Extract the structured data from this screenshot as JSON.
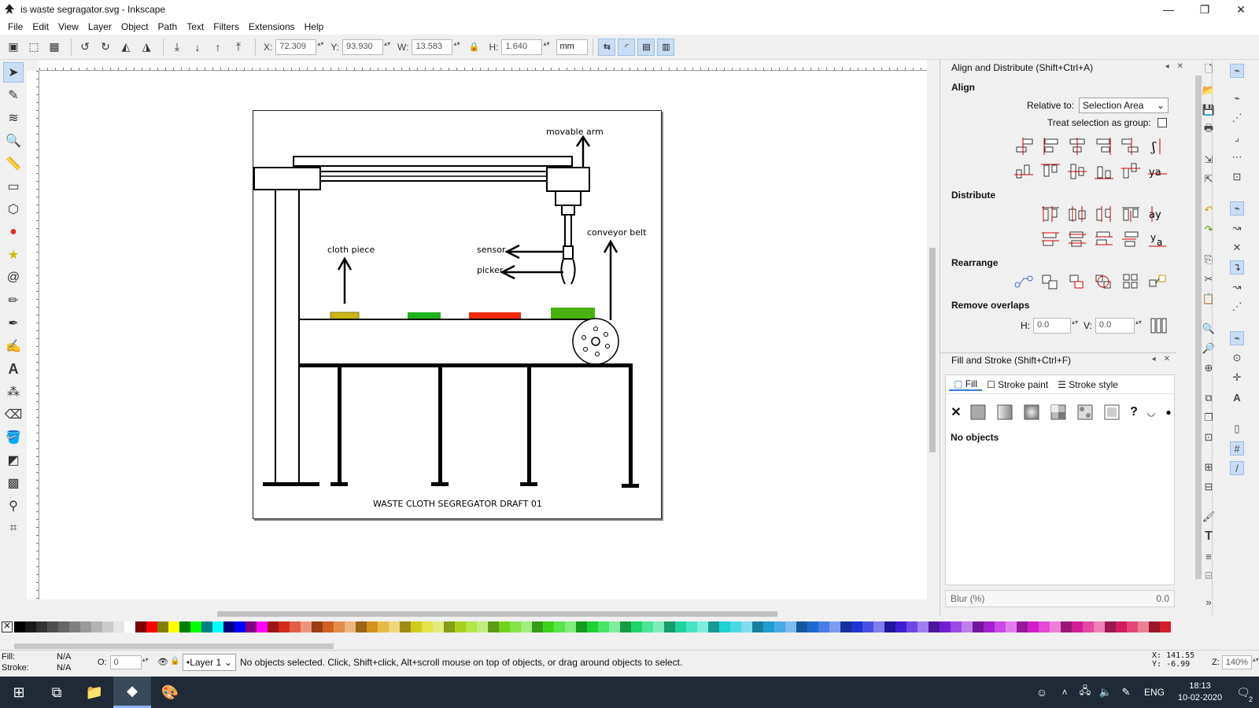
{
  "window": {
    "title": "is waste segragator.svg - Inkscape",
    "minimize": "—",
    "maximize": "❐",
    "close": "✕"
  },
  "menu": [
    "File",
    "Edit",
    "View",
    "Layer",
    "Object",
    "Path",
    "Text",
    "Filters",
    "Extensions",
    "Help"
  ],
  "toolbar": {
    "x_label": "X:",
    "x_value": "72.309",
    "y_label": "Y:",
    "y_value": "93.930",
    "w_label": "W:",
    "w_value": "13.583",
    "h_label": "H:",
    "h_value": "1.640",
    "unit": "mm"
  },
  "drawing": {
    "movable_arm": "movable arm",
    "cloth_piece": "cloth piece",
    "sensor": "sensor",
    "picker": "picker",
    "conveyor_belt": "conveyor belt",
    "caption": "WASTE CLOTH SEGREGATOR DRAFT 01",
    "colors": {
      "yellow": "#c9b41a",
      "green": "#1fb41f",
      "red": "#ee2a0e",
      "green2": "#49b00e"
    }
  },
  "align_panel": {
    "title": "Align and Distribute (Shift+Ctrl+A)",
    "align": "Align",
    "relative_to_label": "Relative to:",
    "relative_to_value": "Selection Area",
    "treat_group": "Treat selection as group:",
    "distribute": "Distribute",
    "rearrange": "Rearrange",
    "remove_overlaps": "Remove overlaps",
    "h_label": "H:",
    "h_value": "0.0",
    "v_label": "V:",
    "v_value": "0.0"
  },
  "fill_panel": {
    "title": "Fill and Stroke (Shift+Ctrl+F)",
    "tab_fill": "Fill",
    "tab_stroke_paint": "Stroke paint",
    "tab_stroke_style": "Stroke style",
    "no_objects": "No objects",
    "blur_label": "Blur (%)",
    "blur_value": "0.0"
  },
  "status": {
    "fill_label": "Fill:",
    "fill_value": "N/A",
    "stroke_label": "Stroke:",
    "stroke_value": "N/A",
    "opacity_label": "O:",
    "opacity_value": "0",
    "layer": "•Layer 1",
    "message": "No objects selected. Click, Shift+click, Alt+scroll mouse on top of objects, or drag around objects to select.",
    "cx_label": "X:",
    "cx_value": "141.55",
    "cy_label": "Y:",
    "cy_value": "-6.99",
    "zoom_label": "Z:",
    "zoom_value": "140%"
  },
  "taskbar": {
    "lang": "ENG",
    "time": "18:13",
    "date": "10-02-2020",
    "notif": "2"
  }
}
